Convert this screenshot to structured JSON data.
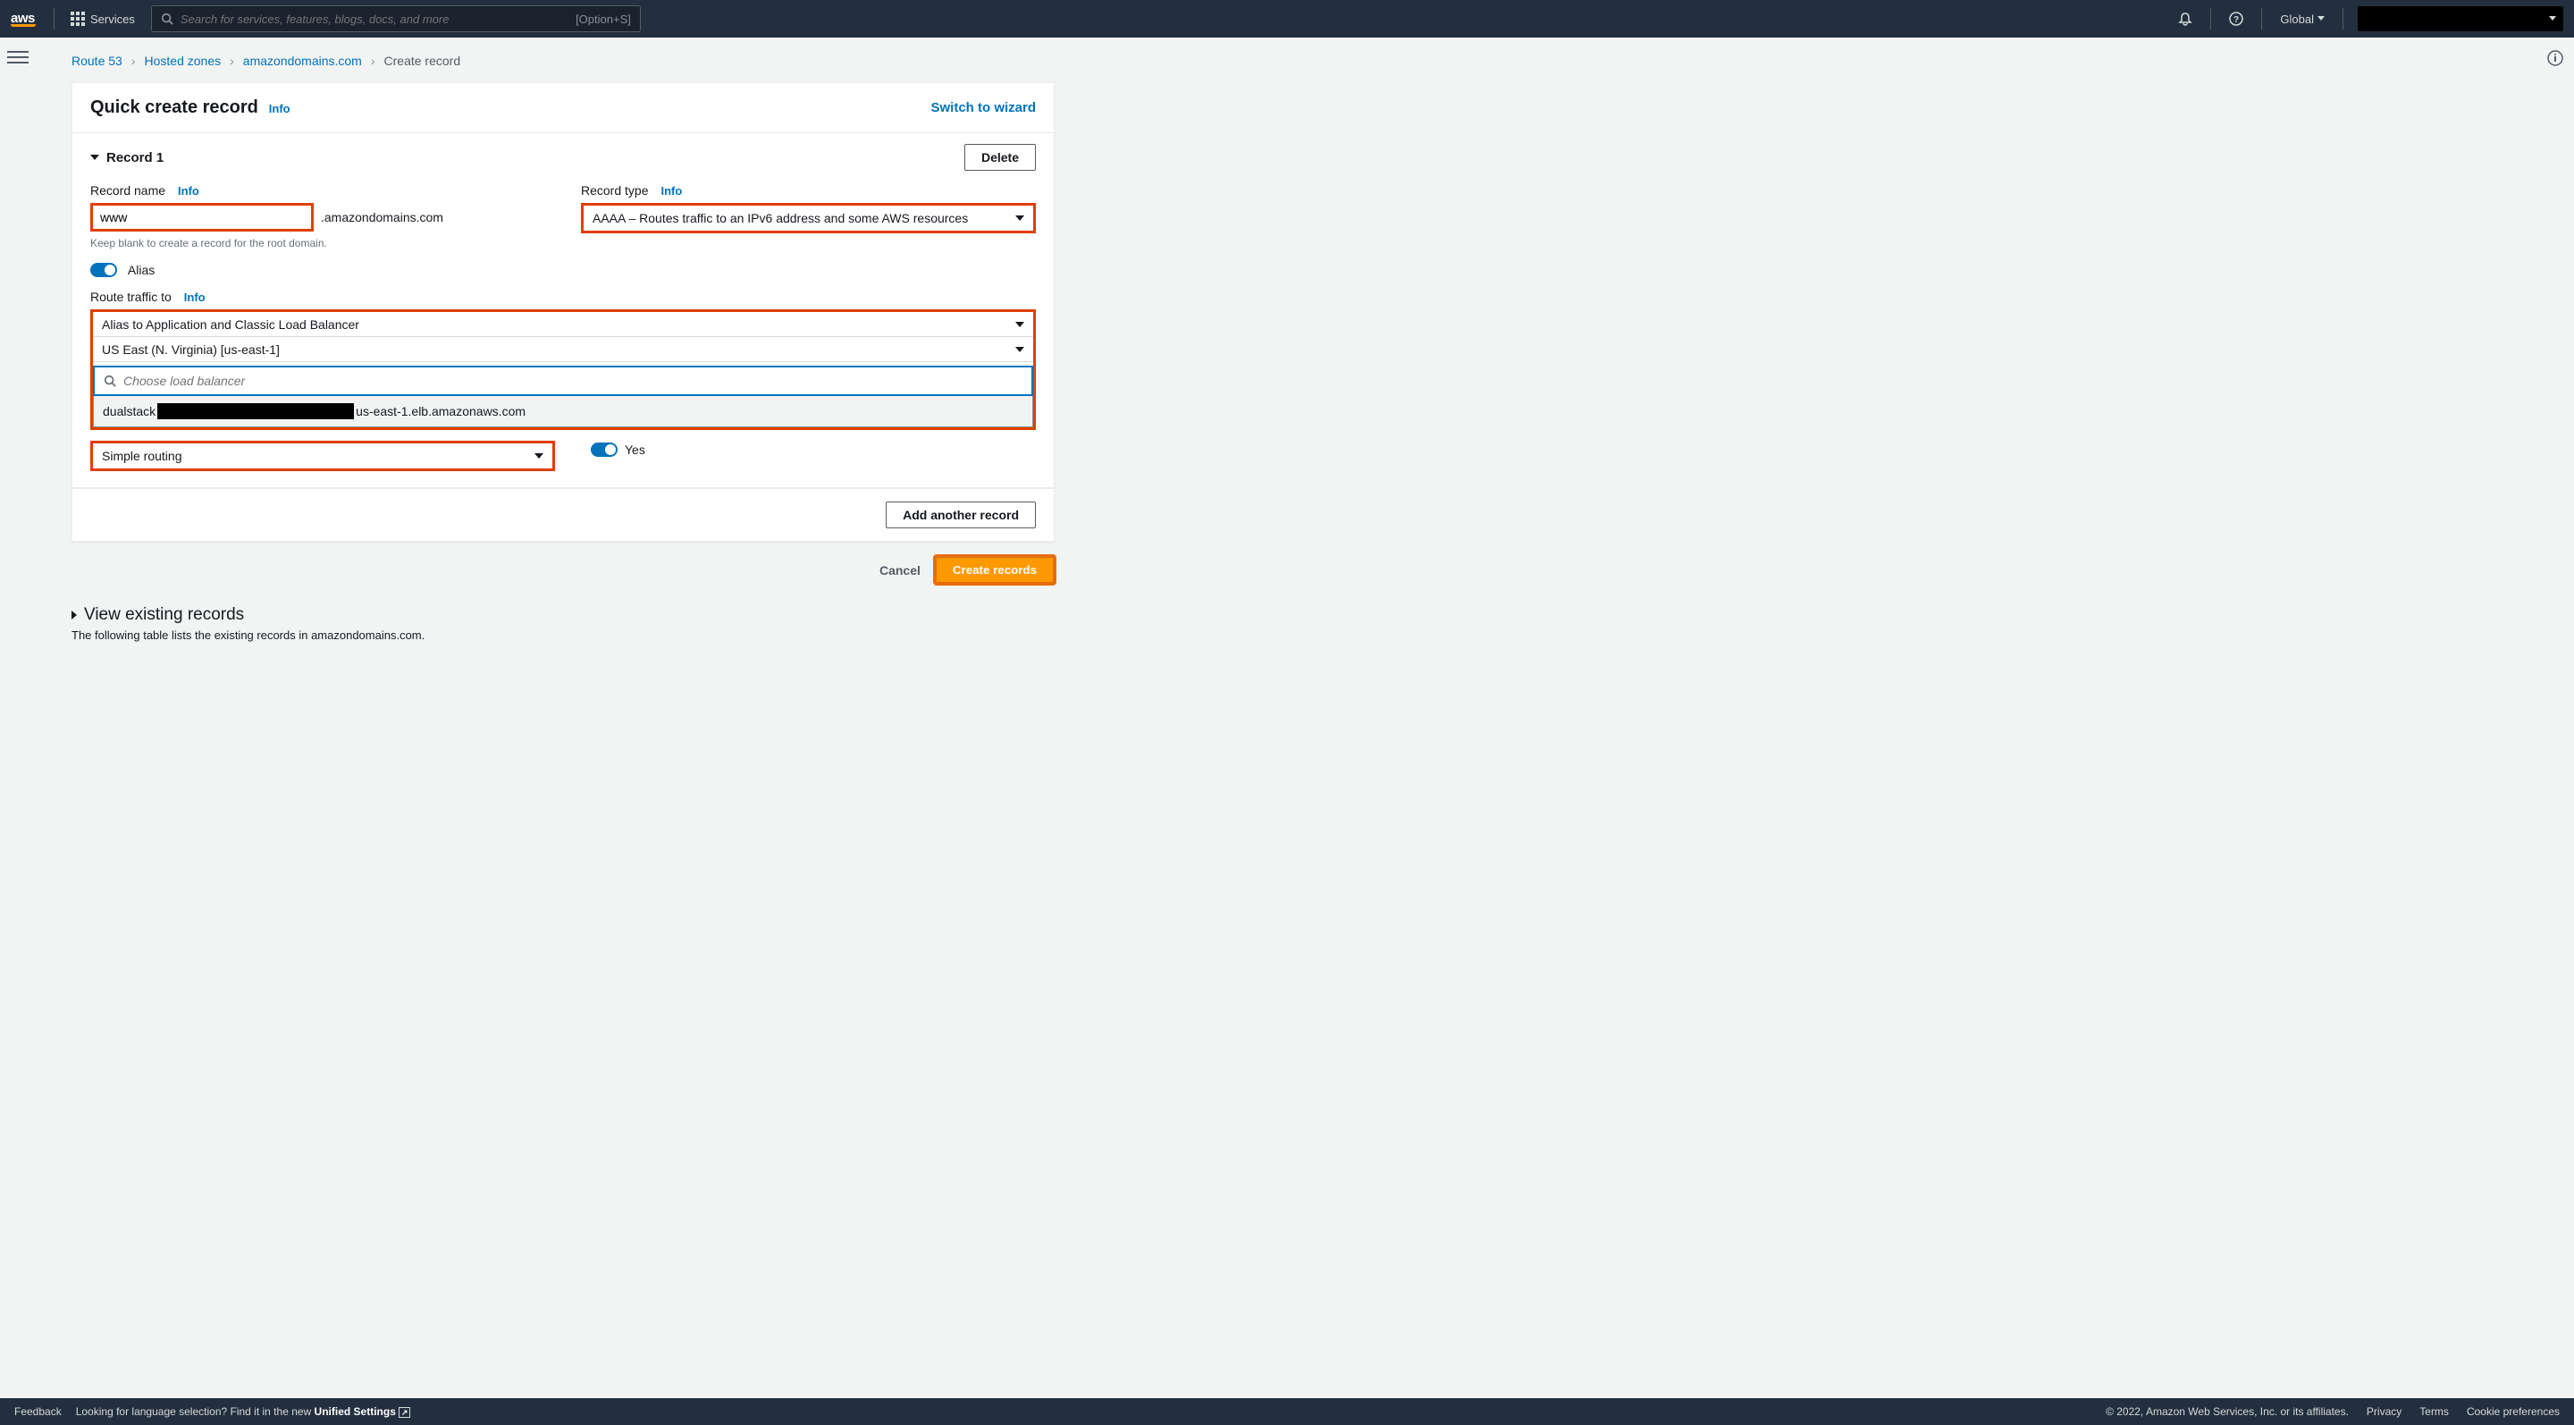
{
  "nav": {
    "services": "Services",
    "search_placeholder": "Search for services, features, blogs, docs, and more",
    "search_shortcut": "[Option+S]",
    "region": "Global"
  },
  "breadcrumbs": {
    "items": [
      "Route 53",
      "Hosted zones",
      "amazondomains.com"
    ],
    "current": "Create record"
  },
  "header": {
    "title": "Quick create record",
    "info": "Info",
    "switch": "Switch to wizard"
  },
  "record": {
    "section_title": "Record 1",
    "delete": "Delete",
    "name_label": "Record name",
    "name_info": "Info",
    "name_value": "www",
    "name_suffix": ".amazondomains.com",
    "name_hint": "Keep blank to create a record for the root domain.",
    "type_label": "Record type",
    "type_info": "Info",
    "type_value": "AAAA – Routes traffic to an IPv6 address and some AWS resources",
    "alias_label": "Alias",
    "route_label": "Route traffic to",
    "route_info": "Info",
    "alias_target": "Alias to Application and Classic Load Balancer",
    "region_value": "US East (N. Virginia) [us-east-1]",
    "lb_placeholder": "Choose load balancer",
    "lb_option_prefix": "dualstack",
    "lb_option_suffix": "us-east-1.elb.amazonaws.com",
    "routing_policy_value": "Simple routing",
    "eval_label": "Yes"
  },
  "footer": {
    "add_another": "Add another record",
    "cancel": "Cancel",
    "create": "Create records"
  },
  "existing": {
    "title": "View existing records",
    "sub": "The following table lists the existing records in amazondomains.com."
  },
  "bottom": {
    "feedback": "Feedback",
    "lang_prompt": "Looking for language selection? Find it in the new ",
    "unified": "Unified Settings",
    "copyright": "© 2022, Amazon Web Services, Inc. or its affiliates.",
    "privacy": "Privacy",
    "terms": "Terms",
    "cookie": "Cookie preferences"
  }
}
